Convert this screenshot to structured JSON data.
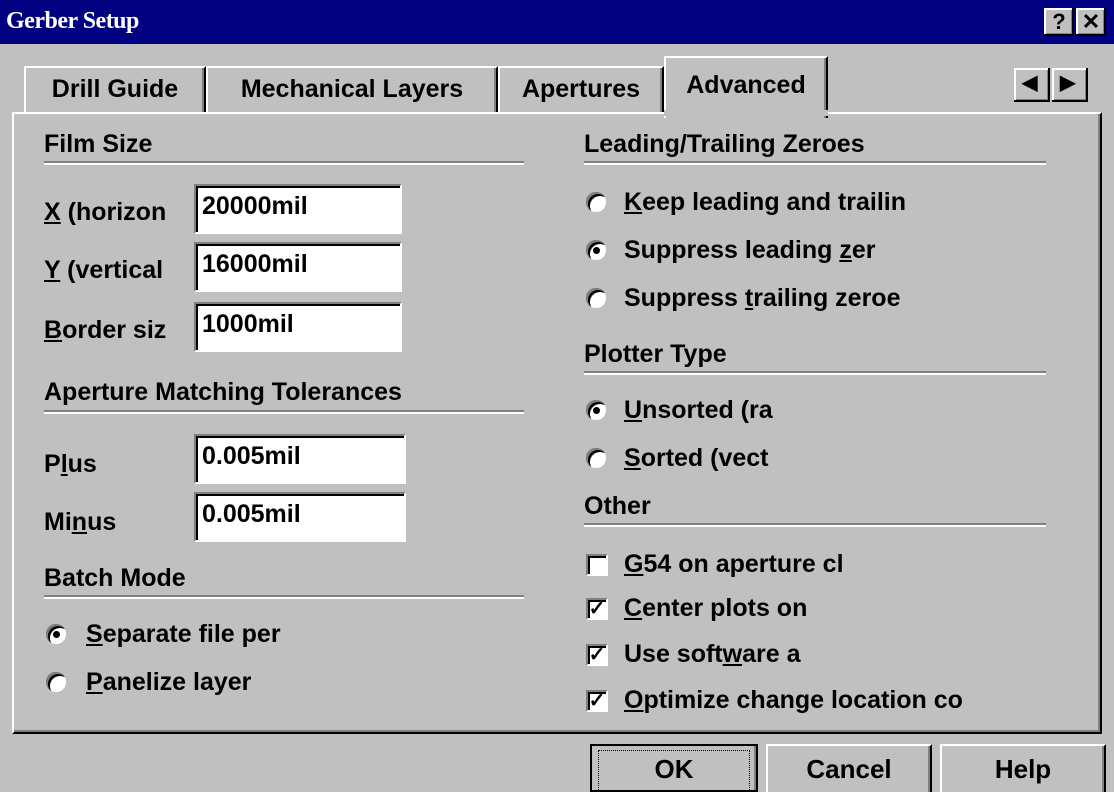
{
  "window": {
    "title": "Gerber Setup",
    "help_glyph": "?",
    "close_glyph": "✕"
  },
  "tabs": [
    {
      "label": "Drill Guide"
    },
    {
      "label": "Mechanical Layers"
    },
    {
      "label": "Apertures"
    },
    {
      "label": "Advanced",
      "active": true
    }
  ],
  "tab_scroll": {
    "left": "◀",
    "right": "▶"
  },
  "film_size": {
    "heading": "Film Size",
    "x_label_mnemonic": "X",
    "x_label_rest": " (horizon",
    "x_value": "20000mil",
    "y_label_mnemonic": "Y",
    "y_label_rest": " (vertical",
    "y_value": "16000mil",
    "border_label_mnemonic": "B",
    "border_label_rest": "order siz",
    "border_value": "1000mil"
  },
  "aperture_tolerances": {
    "heading": "Aperture Matching Tolerances",
    "plus_pre": "P",
    "plus_mnemonic": "l",
    "plus_post": "us",
    "plus_value": "0.005mil",
    "minus_pre": "Mi",
    "minus_mnemonic": "n",
    "minus_post": "us",
    "minus_value": "0.005mil"
  },
  "batch_mode": {
    "heading": "Batch Mode",
    "opt1_mnemonic": "S",
    "opt1_rest": "eparate file per",
    "opt1_selected": true,
    "opt2_mnemonic": "P",
    "opt2_rest": "anelize layer",
    "opt2_selected": false
  },
  "zeroes": {
    "heading": "Leading/Trailing Zeroes",
    "opt1_mnemonic": "K",
    "opt1_rest": "eep leading and trailin",
    "opt1_selected": false,
    "opt2_pre": "Suppress leading ",
    "opt2_mnemonic": "z",
    "opt2_post": "er",
    "opt2_selected": true,
    "opt3_pre": "Suppress ",
    "opt3_mnemonic": "t",
    "opt3_post": "railing zeroe",
    "opt3_selected": false
  },
  "plotter_type": {
    "heading": "Plotter Type",
    "opt1_mnemonic": "U",
    "opt1_rest": "nsorted (ra",
    "opt1_selected": true,
    "opt2_mnemonic": "S",
    "opt2_rest": "orted (vect",
    "opt2_selected": false
  },
  "other": {
    "heading": "Other",
    "cb1_mnemonic": "G",
    "cb1_rest": "54 on aperture cl",
    "cb1_checked": false,
    "cb2_mnemonic": "C",
    "cb2_rest": "enter plots on",
    "cb2_checked": true,
    "cb3_pre": "Use soft",
    "cb3_mnemonic": "w",
    "cb3_post": "are a",
    "cb3_checked": true,
    "cb4_mnemonic": "O",
    "cb4_rest": "ptimize change location co",
    "cb4_checked": true,
    "check_glyph": "✓"
  },
  "buttons": {
    "ok": "OK",
    "cancel": "Cancel",
    "help": "Help"
  }
}
